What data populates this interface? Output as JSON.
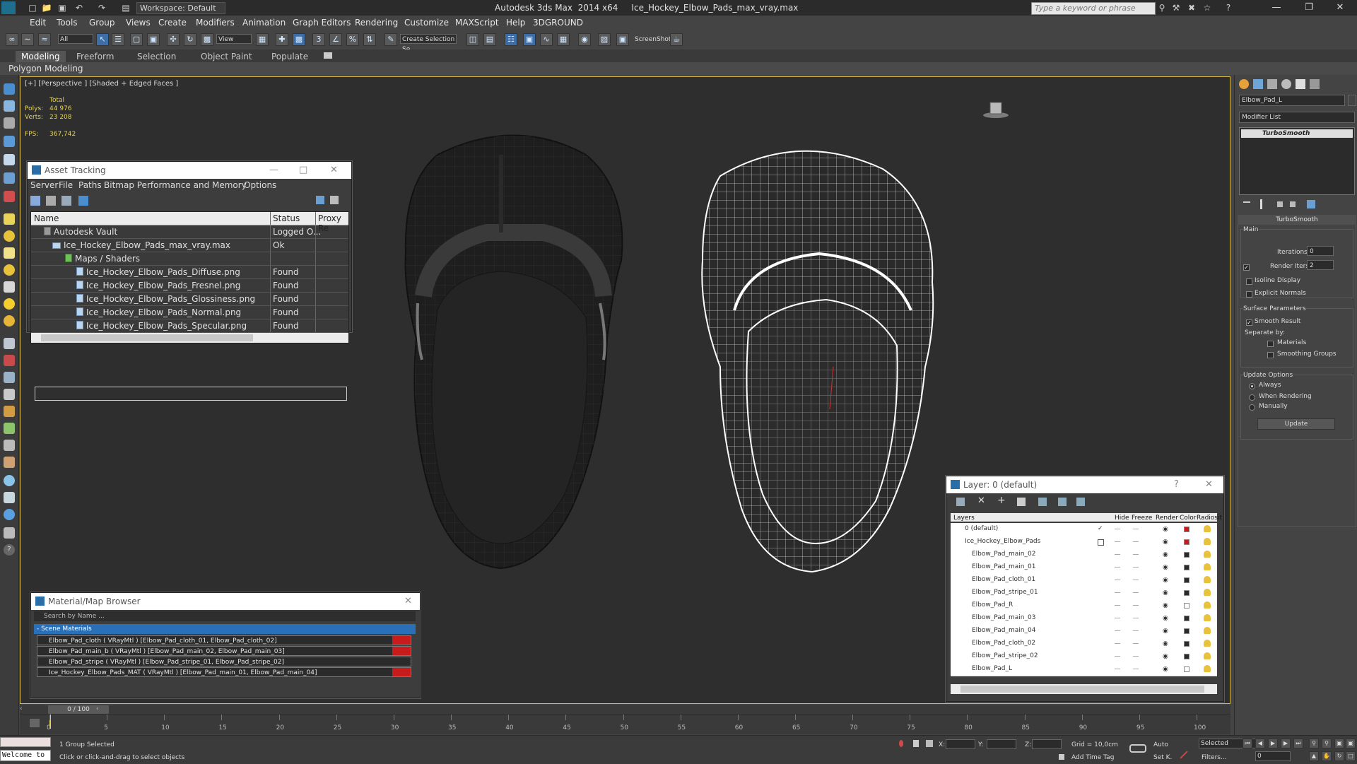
{
  "titlebar": {
    "workspace": "Workspace: Default",
    "title": "Autodesk 3ds Max  2014 x64     Ice_Hockey_Elbow_Pads_max_vray.max",
    "search_placeholder": "Type a keyword or phrase"
  },
  "menu": [
    "Edit",
    "Tools",
    "Group",
    "Views",
    "Create",
    "Modifiers",
    "Animation",
    "Graph Editors",
    "Rendering",
    "Customize",
    "MAXScript",
    "Help",
    "3DGROUND"
  ],
  "toolbar": {
    "filter": "All",
    "ref_coord": "View",
    "selection_set": "Create Selection Se",
    "screenshot_label": "ScreenShot"
  },
  "ribbon": {
    "tabs": [
      "Modeling",
      "Freeform",
      "Selection",
      "Object Paint",
      "Populate"
    ],
    "active": "Modeling",
    "panel": "Polygon Modeling"
  },
  "viewport": {
    "label": "[+] [Perspective ] [Shaded + Edged Faces ]",
    "stats": {
      "total_label": "Total",
      "polys_label": "Polys:",
      "polys": "44 976",
      "verts_label": "Verts:",
      "verts": "23 208",
      "fps_label": "FPS:",
      "fps": "367,742"
    }
  },
  "asset_tracking": {
    "title": "Asset Tracking",
    "menu": [
      "Server",
      "File",
      "Paths",
      "Bitmap Performance and Memory",
      "Options"
    ],
    "columns": [
      "Name",
      "Status",
      "Proxy Re"
    ],
    "rows": [
      {
        "name": "Autodesk Vault",
        "status": "Logged O..."
      },
      {
        "name": "Ice_Hockey_Elbow_Pads_max_vray.max",
        "status": "Ok"
      },
      {
        "name": "Maps / Shaders",
        "status": ""
      },
      {
        "name": "Ice_Hockey_Elbow_Pads_Diffuse.png",
        "status": "Found"
      },
      {
        "name": "Ice_Hockey_Elbow_Pads_Fresnel.png",
        "status": "Found"
      },
      {
        "name": "Ice_Hockey_Elbow_Pads_Glossiness.png",
        "status": "Found"
      },
      {
        "name": "Ice_Hockey_Elbow_Pads_Normal.png",
        "status": "Found"
      },
      {
        "name": "Ice_Hockey_Elbow_Pads_Specular.png",
        "status": "Found"
      }
    ]
  },
  "material_browser": {
    "title": "Material/Map Browser",
    "search_placeholder": "Search by Name ...",
    "group": "- Scene Materials",
    "items": [
      "Elbow_Pad_cloth ( VRayMtl ) [Elbow_Pad_cloth_01, Elbow_Pad_cloth_02]",
      "Elbow_Pad_main_b ( VRayMtl ) [Elbow_Pad_main_02, Elbow_Pad_main_03]",
      "Elbow_Pad_stripe ( VRayMtl ) [Elbow_Pad_stripe_01, Elbow_Pad_stripe_02]",
      "Ice_Hockey_Elbow_Pads_MAT ( VRayMtl ) [Elbow_Pad_main_01, Elbow_Pad_main_04]"
    ]
  },
  "layer_manager": {
    "title": "Layer: 0 (default)",
    "columns": [
      "Layers",
      "Hide",
      "Freeze",
      "Render",
      "Color",
      "Radiosit"
    ],
    "rows": [
      {
        "name": "0 (default)"
      },
      {
        "name": "Ice_Hockey_Elbow_Pads"
      },
      {
        "name": "Elbow_Pad_main_02"
      },
      {
        "name": "Elbow_Pad_main_01"
      },
      {
        "name": "Elbow_Pad_cloth_01"
      },
      {
        "name": "Elbow_Pad_stripe_01"
      },
      {
        "name": "Elbow_Pad_R"
      },
      {
        "name": "Elbow_Pad_main_03"
      },
      {
        "name": "Elbow_Pad_main_04"
      },
      {
        "name": "Elbow_Pad_cloth_02"
      },
      {
        "name": "Elbow_Pad_stripe_02"
      },
      {
        "name": "Elbow_Pad_L"
      }
    ]
  },
  "command_panel": {
    "object_name": "Elbow_Pad_L",
    "modifier_list": "Modifier List",
    "modifier_stack": [
      "TurboSmooth"
    ],
    "rollout_title": "TurboSmooth",
    "main_label": "Main",
    "iterations_label": "Iterations:",
    "iterations": "0",
    "render_iters_label": "Render Iters:",
    "render_iters": "2",
    "isoline": "Isoline Display",
    "explicit_normals": "Explicit Normals",
    "surface_params": "Surface Parameters",
    "smooth_result": "Smooth Result",
    "separate_by": "Separate by:",
    "materials": "Materials",
    "smoothing_groups": "Smoothing Groups",
    "update_options": "Update Options",
    "always": "Always",
    "when_rendering": "When Rendering",
    "manually": "Manually",
    "update_button": "Update"
  },
  "timeline": {
    "frame": "0 / 100",
    "ticks": [
      "0",
      "5",
      "10",
      "15",
      "20",
      "25",
      "30",
      "35",
      "40",
      "45",
      "50",
      "55",
      "60",
      "65",
      "70",
      "75",
      "80",
      "85",
      "90",
      "95",
      "100"
    ]
  },
  "status": {
    "maxscript": "Welcome to",
    "selection": "1 Group Selected",
    "prompt": "Click or click-and-drag to select objects",
    "x_label": "X:",
    "y_label": "Y:",
    "z_label": "Z:",
    "grid": "Grid = 10,0cm",
    "add_time_tag": "Add Time Tag",
    "auto": "Auto",
    "set_k": "Set K.",
    "selected": "Selected",
    "filters": "Filters...",
    "frame_value": "0"
  }
}
